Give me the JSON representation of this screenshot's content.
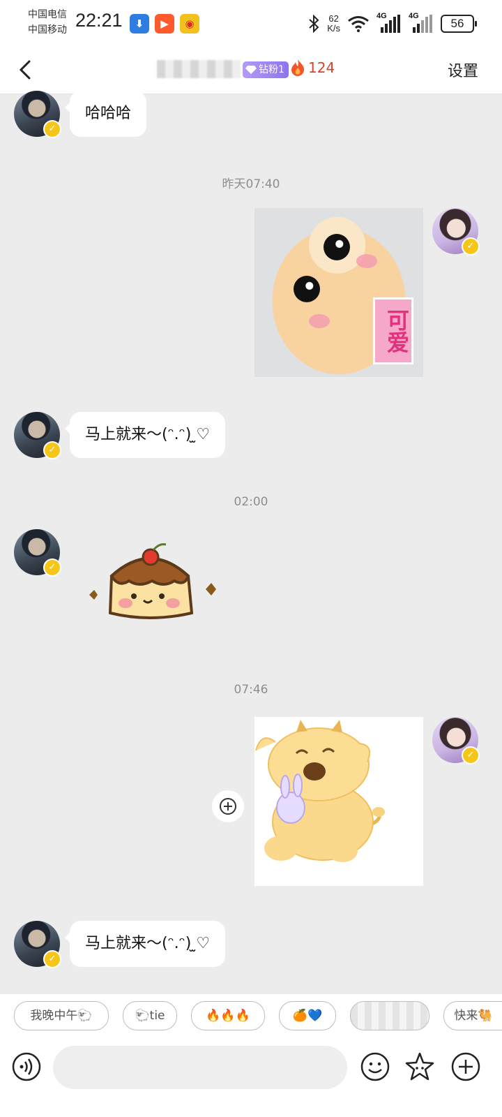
{
  "status_bar": {
    "carrier_1": "中国电信",
    "carrier_2": "中国移动",
    "time": "22:21",
    "net_speed_value": "62",
    "net_speed_unit": "K/s",
    "signal_1": "4G",
    "signal_2": "4G",
    "battery": "56",
    "app_icons": [
      "app-store-icon",
      "kuaishou-icon",
      "weibo-icon"
    ]
  },
  "header": {
    "fan_badge": "钻粉1",
    "streak_count": "124",
    "settings_label": "设置"
  },
  "messages": [
    {
      "side": "left",
      "type": "text",
      "text": "哈哈哈"
    },
    {
      "type": "timestamp",
      "text": "昨天07:40"
    },
    {
      "side": "right",
      "type": "image",
      "image_caption": "可爱"
    },
    {
      "side": "left",
      "type": "text",
      "text": "马上就来～(ᵔ.ᵔ) ̫♡"
    },
    {
      "type": "timestamp",
      "text": "02:00"
    },
    {
      "side": "left",
      "type": "sticker",
      "sticker": "pudding-sticker"
    },
    {
      "type": "timestamp",
      "text": "07:46"
    },
    {
      "side": "right",
      "type": "image",
      "sticker": "cow-sticker"
    },
    {
      "side": "left",
      "type": "text",
      "text": "马上就来～(ᵔ.ᵔ) ̫♡"
    }
  ],
  "quick_replies": [
    "我晚中午🐑",
    "🐑tie",
    "🔥🔥🔥",
    "🍊💙",
    "",
    "快来🐫"
  ],
  "input": {
    "placeholder": ""
  },
  "colors": {
    "background": "#ececec",
    "fan_badge": "#9b82f0",
    "streak": "#d6442a",
    "verified": "#f5c518"
  }
}
